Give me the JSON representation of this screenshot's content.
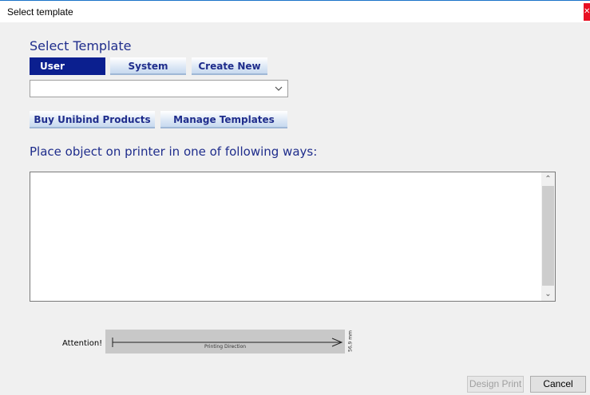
{
  "window": {
    "title": "Select template"
  },
  "heading": "Select Template",
  "tabs": [
    {
      "label": "User",
      "active": true
    },
    {
      "label": "System",
      "active": false
    },
    {
      "label": "Create New",
      "active": false
    }
  ],
  "template_select": {
    "value": ""
  },
  "actions": {
    "buy_label": "Buy Unibind Products",
    "manage_label": "Manage Templates"
  },
  "placement": {
    "instruction": "Place object on printer in one of following ways:"
  },
  "printing": {
    "attention_label": "Attention!",
    "direction_label": "Printing Direction",
    "size_label": "56,9 mm"
  },
  "footer": {
    "design_print_label": "Design Print",
    "cancel_label": "Cancel"
  },
  "colors": {
    "accent": "#1f2d8c",
    "active_tab": "#0b1f8f",
    "title_border": "#1a73c9",
    "close": "#e81123"
  }
}
